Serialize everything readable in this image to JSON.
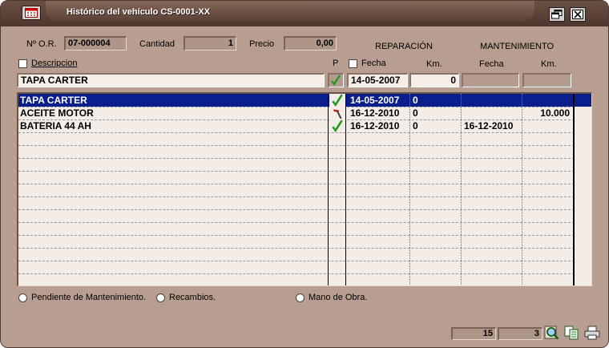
{
  "window": {
    "title": "Histórico del vehículo CS-0001-XX"
  },
  "header": {
    "no_label": "Nº O.R.",
    "no_value": "07-000004",
    "cantidad_label": "Cantidad",
    "cantidad_value": "1",
    "precio_label": "Precio",
    "precio_value": "0,00",
    "reparacion_label": "REPARACIÓN",
    "mantenimiento_label": "MANTENIMIENTO"
  },
  "columns": {
    "descripcion": "Descripcion",
    "p": "P",
    "fecha": "Fecha",
    "km": "Km.",
    "fecha2": "Fecha",
    "km2": "Km."
  },
  "edit": {
    "descripcion": "TAPA CARTER",
    "fecha": "14-05-2007",
    "km": "0",
    "fecha2": "",
    "km2": ""
  },
  "rows": [
    {
      "descripcion": "TAPA CARTER",
      "p_icon": "check-icon",
      "fecha": "14-05-2007",
      "km": "0",
      "fecha2": "",
      "km2": "",
      "selected": true
    },
    {
      "descripcion": "ACEITE MOTOR",
      "p_icon": "hammer-icon",
      "fecha": "16-12-2010",
      "km": "0",
      "fecha2": "",
      "km2": "10.000",
      "selected": false
    },
    {
      "descripcion": "BATERIA 44 AH",
      "p_icon": "check-icon",
      "fecha": "16-12-2010",
      "km": "0",
      "fecha2": "16-12-2010",
      "km2": "",
      "selected": false
    }
  ],
  "filters": {
    "pendiente": "Pendiente de Mantenimiento.",
    "recambios": "Recambios.",
    "mano_obra": "Mano de Obra."
  },
  "status": {
    "total": "15",
    "current": "3"
  },
  "colors": {
    "selection": "#0a1e8c",
    "window_bg": "#b89e90",
    "check": "#1a9a1a"
  }
}
